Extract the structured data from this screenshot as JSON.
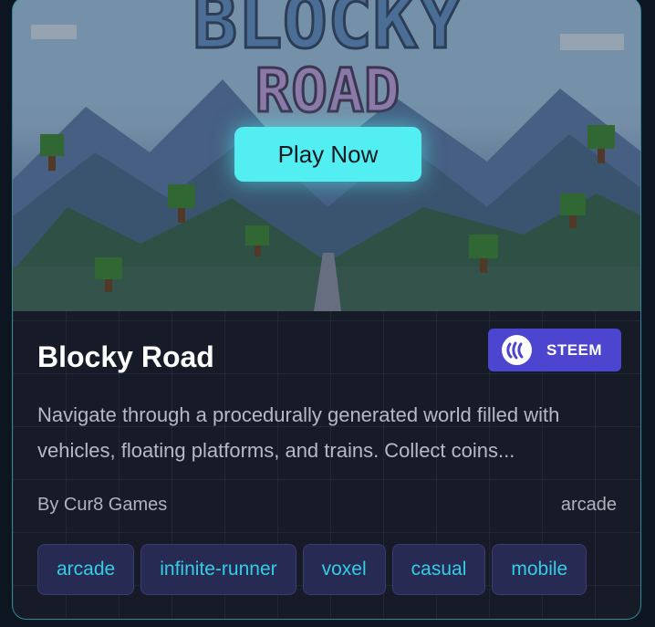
{
  "game": {
    "title": "Blocky Road",
    "play_label": "Play Now",
    "banner_title_line1": "BLOCKY",
    "banner_title_line2": "ROAD",
    "chain": "STEEM",
    "description": "Navigate through a procedurally generated world filled with vehicles, floating platforms, and trains. Collect coins...",
    "author": "By Cur8 Games",
    "category": "arcade",
    "tags": [
      "arcade",
      "infinite-runner",
      "voxel",
      "casual",
      "mobile"
    ]
  },
  "colors": {
    "accent": "#53eef2",
    "badge": "#4d45cf",
    "tag_text": "#35cde6",
    "tag_bg": "#272a52",
    "card_border": "#2b8a9a"
  },
  "icons": {
    "chain_logo": "steem-logo-icon"
  }
}
